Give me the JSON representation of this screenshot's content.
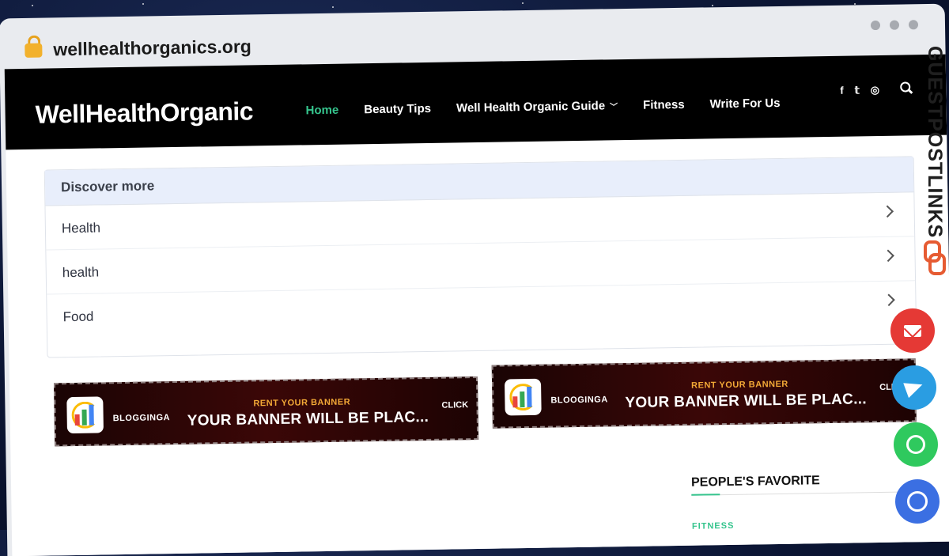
{
  "browser": {
    "url": "wellhealthorganics.org"
  },
  "header": {
    "logo": "WellHealthOrganic",
    "nav": [
      {
        "label": "Home",
        "active": true
      },
      {
        "label": "Beauty Tips"
      },
      {
        "label": "Well Health Organic Guide",
        "has_dropdown": true
      },
      {
        "label": "Fitness"
      },
      {
        "label": "Write For Us"
      }
    ],
    "social": [
      "f",
      "𝕥",
      "◎"
    ]
  },
  "discover": {
    "title": "Discover more",
    "items": [
      "Health",
      "health",
      "Food"
    ]
  },
  "banners": [
    {
      "brand": "BLOGGINGA",
      "tagline": "RENT YOUR BANNER",
      "headline": "YOUR BANNER WILL BE PLAC...",
      "cta": "CLICK"
    },
    {
      "brand": "BLOOGINGA",
      "tagline": "RENT YOUR BANNER",
      "headline": "YOUR BANNER WILL BE PLAC...",
      "cta": "CLIC"
    }
  ],
  "sidebar": {
    "section_title": "PEOPLE'S FAVORITE",
    "category": "FITNESS"
  },
  "watermark": "GUESTPOSTLINKS",
  "colors": {
    "accent": "#35c48d",
    "header_bg": "#000000",
    "mail": "#e53935",
    "telegram": "#2a9de2",
    "whatsapp": "#2fc95e",
    "chat": "#3b6fe2"
  }
}
